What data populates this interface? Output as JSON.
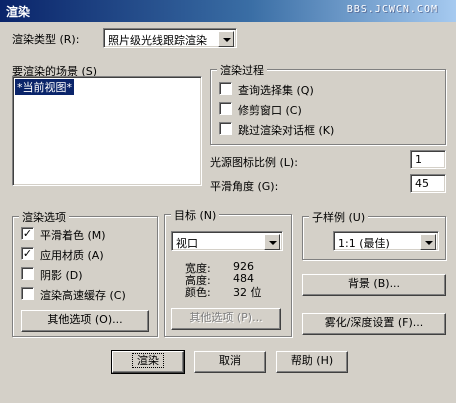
{
  "window": {
    "title": "渲染",
    "watermark": "BBS.JCWCN.COM"
  },
  "render_type": {
    "label": "渲染类型 (R):",
    "value": "照片级光线跟踪渲染"
  },
  "scenes": {
    "label": "要渲染的场景 (S)",
    "items": [
      "*当前视图*"
    ]
  },
  "render_process": {
    "title": "渲染过程",
    "options": [
      {
        "label": "查询选择集 (Q)",
        "checked": false
      },
      {
        "label": "修剪窗口 (C)",
        "checked": false
      },
      {
        "label": "跳过渲染对话框 (K)",
        "checked": false
      }
    ]
  },
  "light_icon_scale": {
    "label": "光源图标比例 (L):",
    "value": "1"
  },
  "smoothing_angle": {
    "label": "平滑角度 (G):",
    "value": "45"
  },
  "render_options": {
    "title": "渲染选项",
    "options": [
      {
        "label": "平滑着色 (M)",
        "checked": true
      },
      {
        "label": "应用材质 (A)",
        "checked": true
      },
      {
        "label": "阴影 (D)",
        "checked": false
      },
      {
        "label": "渲染高速缓存 (C)",
        "checked": false
      }
    ],
    "more_button": "其他选项 (O)..."
  },
  "destination": {
    "title": "目标 (N)",
    "value": "视口",
    "info": {
      "width_label": "宽度:",
      "width": "926",
      "height_label": "高度:",
      "height": "484",
      "colors_label": "颜色:",
      "colors": "32 位"
    },
    "more_button": "其他选项 (P)..."
  },
  "subsampling": {
    "title": "子样例 (U)",
    "value": "1:1 (最佳)"
  },
  "buttons": {
    "background": "背景 (B)...",
    "fog": "雾化/深度设置 (F)...",
    "render": "渲染",
    "cancel": "取消",
    "help": "帮助 (H)"
  },
  "checkmark": "✓"
}
